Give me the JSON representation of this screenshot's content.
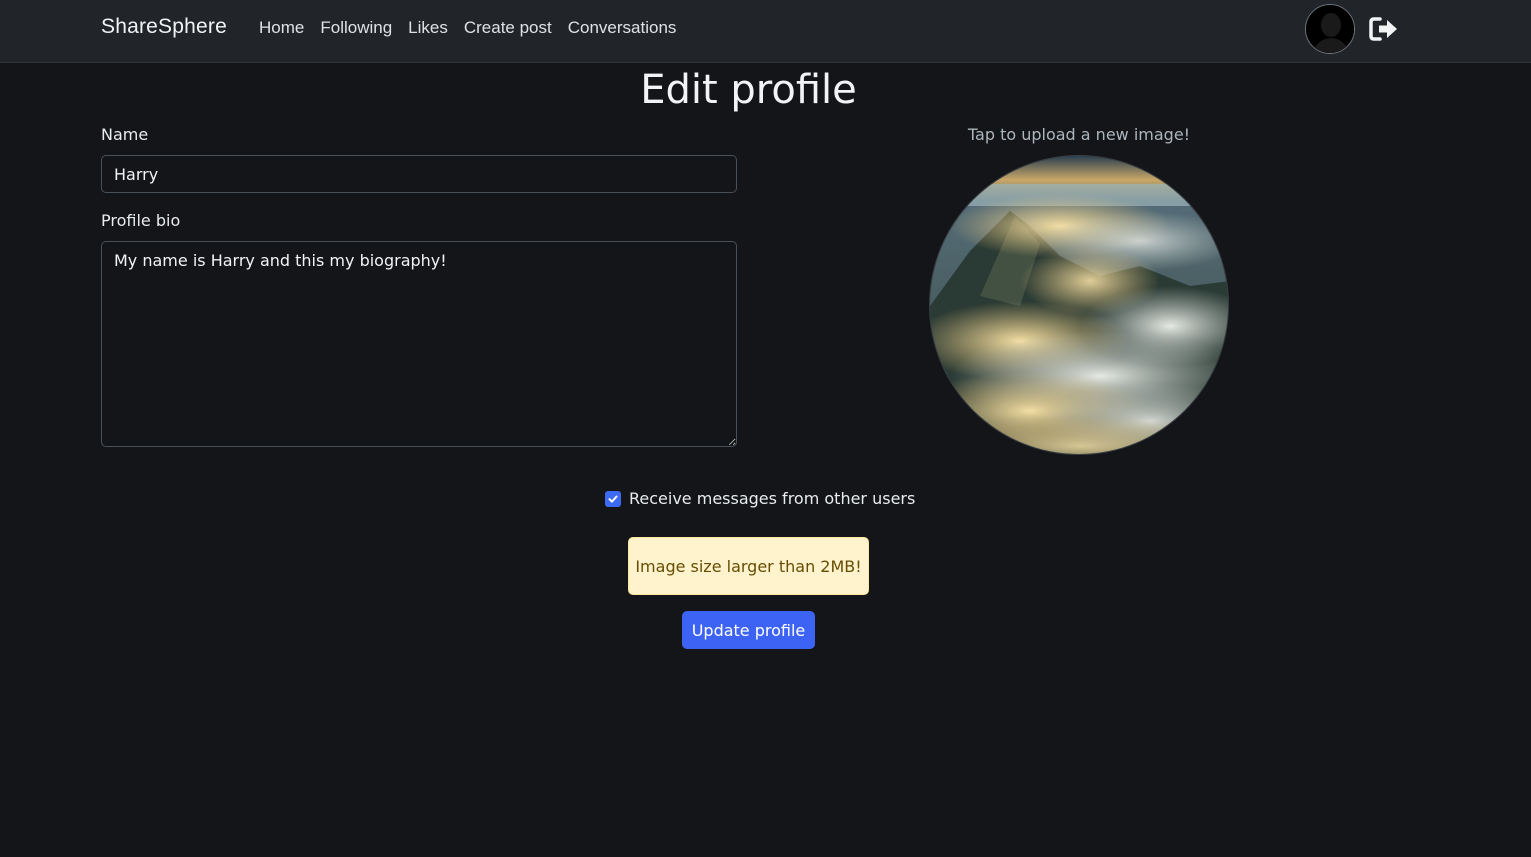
{
  "navbar": {
    "brand": "ShareSphere",
    "links": [
      "Home",
      "Following",
      "Likes",
      "Create post",
      "Conversations"
    ],
    "avatar_icon": "user-silhouette-icon",
    "logout_icon": "sign-out-icon"
  },
  "page": {
    "title": "Edit profile"
  },
  "form": {
    "name_label": "Name",
    "name_value": "Harry",
    "bio_label": "Profile bio",
    "bio_value": "My name is Harry and this my biography!",
    "receive_messages_label": "Receive messages from other users",
    "receive_messages_checked": true,
    "alert_text": "Image size larger than 2MB!",
    "submit_label": "Update profile"
  },
  "profile_image": {
    "hint": "Tap to upload a new image!"
  },
  "colors": {
    "background": "#131518",
    "navbar": "#212529",
    "primary": "#3d63f5",
    "alert_bg": "#fff3cd",
    "alert_text": "#664d03"
  }
}
